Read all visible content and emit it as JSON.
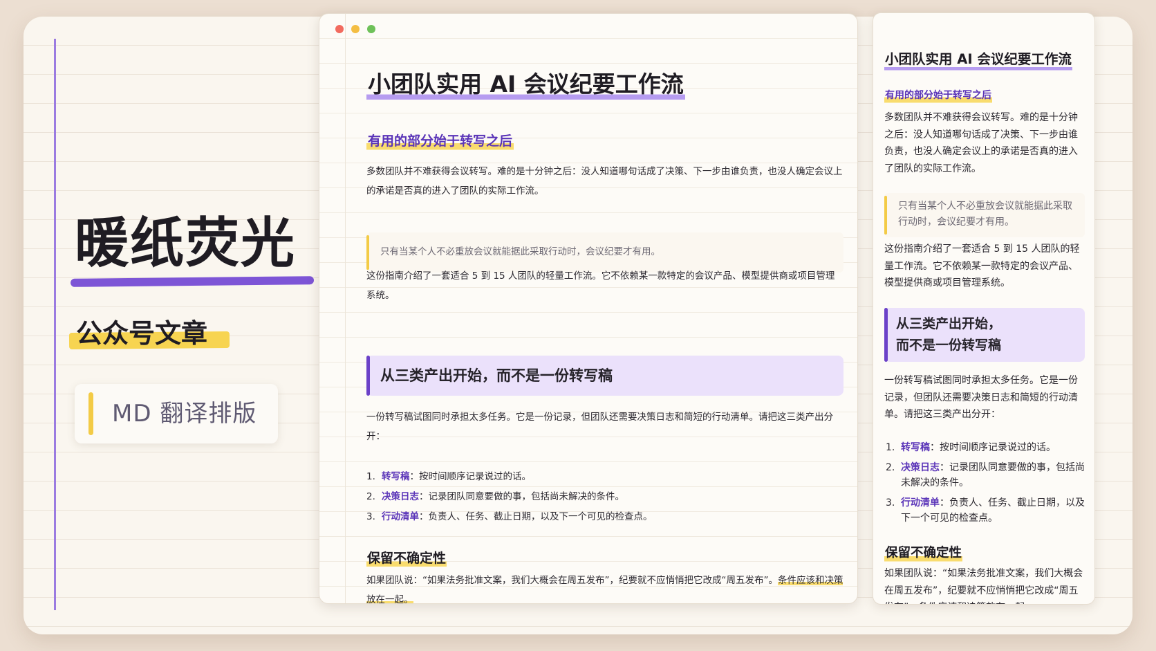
{
  "brand": {
    "title": "暖纸荧光",
    "subtitle": "公众号文章",
    "card_label": "MD 翻译排版"
  },
  "article": {
    "title": "小团队实用 AI 会议纪要工作流",
    "subtitle": "有用的部分始于转写之后",
    "intro": "多数团队并不难获得会议转写。难的是十分钟之后：没人知道哪句话成了决策、下一步由谁负责，也没人确定会议上的承诺是否真的进入了团队的实际工作流。",
    "quote": "只有当某个人不必重放会议就能据此采取行动时，会议纪要才有用。",
    "guide": "这份指南介绍了一套适合 5 到 15 人团队的轻量工作流。它不依赖某一款特定的会议产品、模型提供商或项目管理系统。",
    "section_heading": "从三类产出开始，而不是一份转写稿",
    "section_heading_lines": [
      "从三类产出开始，",
      "而不是一份转写稿"
    ],
    "section_body": "一份转写稿试图同时承担太多任务。它是一份记录，但团队还需要决策日志和简短的行动清单。请把这三类产出分开：",
    "outputs": [
      {
        "num": "1.",
        "term": "转写稿",
        "desc": "：按时间顺序记录说过的话。"
      },
      {
        "num": "2.",
        "term": "决策日志",
        "desc": "：记录团队同意要做的事，包括尚未解决的条件。"
      },
      {
        "num": "3.",
        "term": "行动清单",
        "desc": "：负责人、任务、截止日期，以及下一个可见的检查点。"
      }
    ],
    "subheading": "保留不确定性",
    "closing": "如果团队说：“如果法务批准文案，我们大概会在周五发布”，纪要就不应悄悄把它改成“周五发布”。",
    "closing_highlight": "条件应该和决策放在一起。"
  },
  "colors": {
    "accent_purple": "#6b41c8",
    "highlight_yellow": "#f9dc6e",
    "paper": "#faf6ef"
  },
  "icons": {
    "window_controls": [
      "close-dot",
      "minimize-dot",
      "zoom-dot"
    ]
  }
}
